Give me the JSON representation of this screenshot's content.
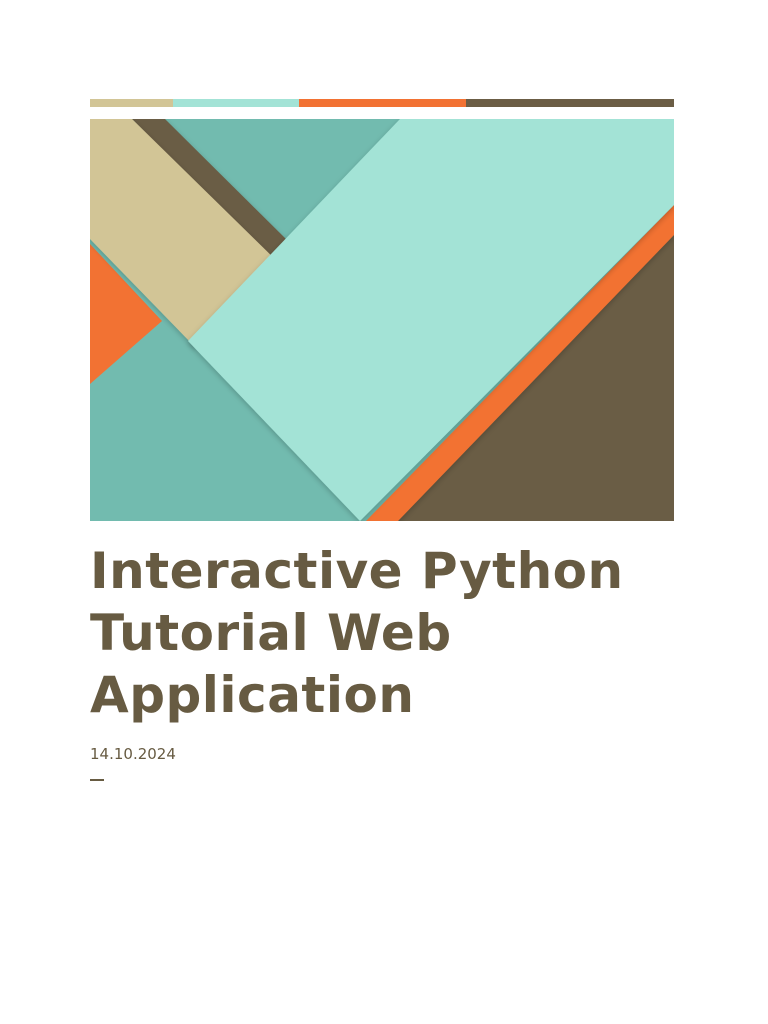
{
  "document": {
    "title_lines": [
      "Interactive Python",
      "Tutorial Web",
      "Application"
    ],
    "date": "14.10.2024"
  },
  "colors": {
    "tan": "#d2c596",
    "mint": "#a3e3d6",
    "teal": "#72bbaf",
    "orange": "#f27233",
    "brown": "#6b5d45",
    "text_brown": "#675b42"
  }
}
